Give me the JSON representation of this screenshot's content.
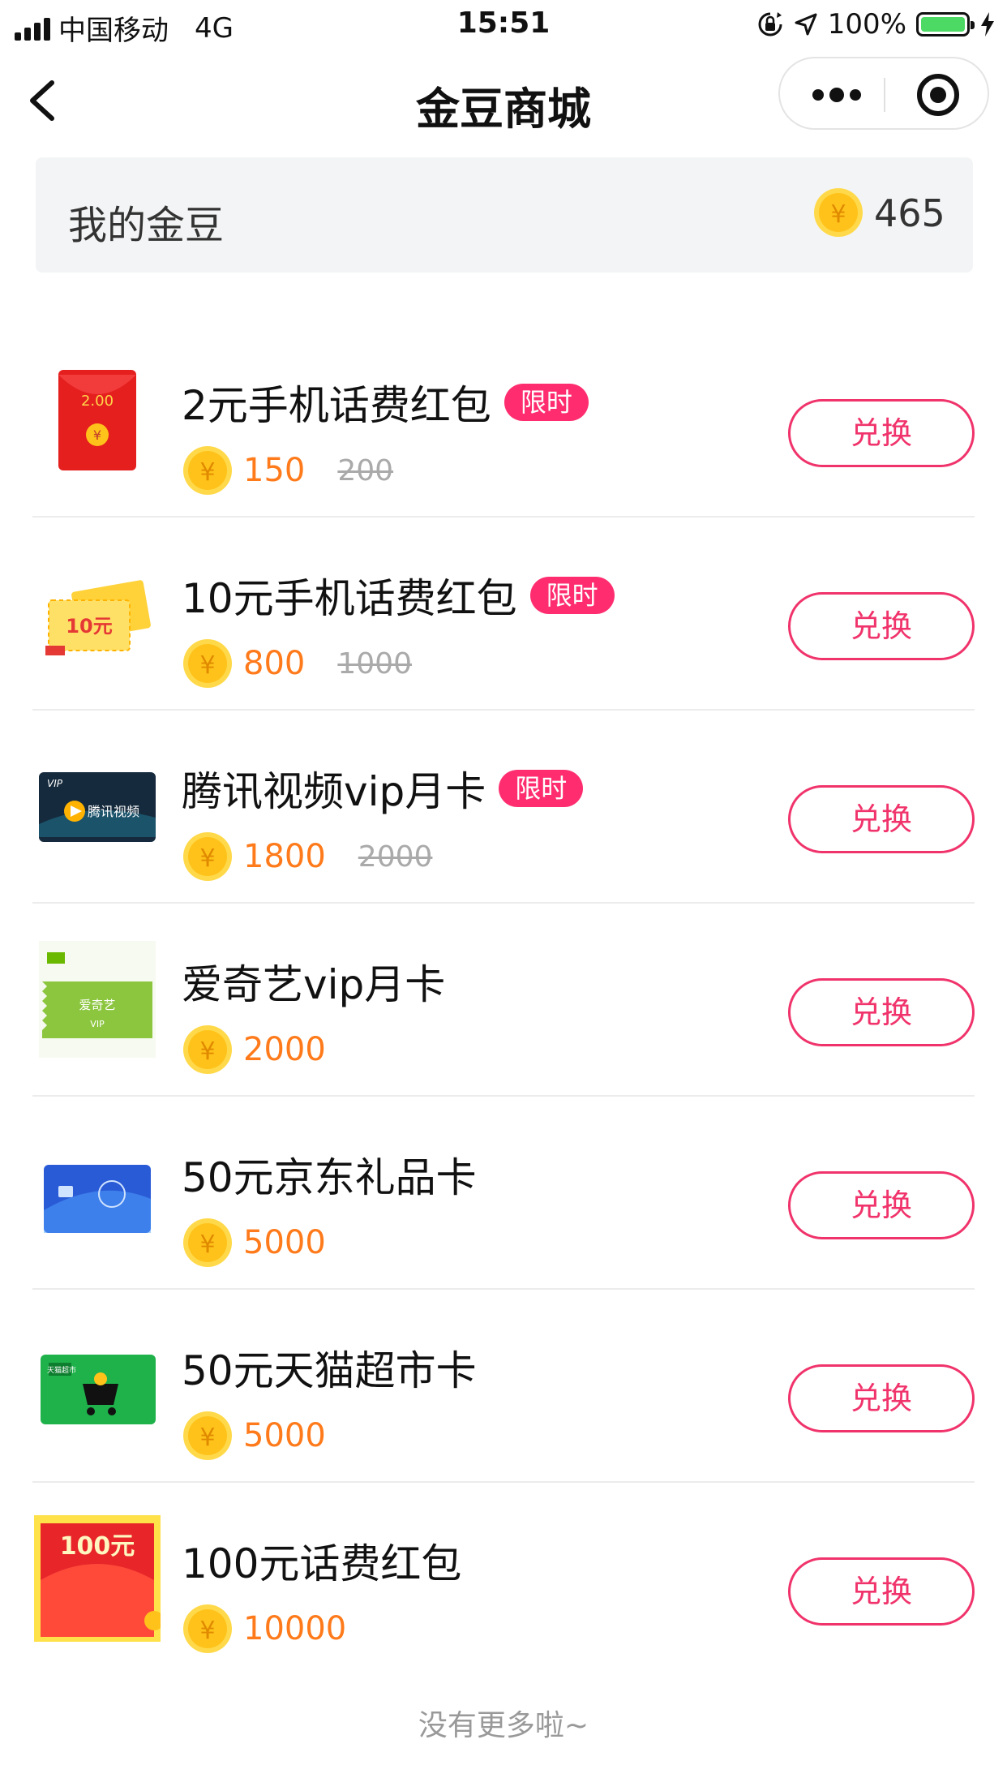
{
  "status_bar": {
    "carrier": "中国移动",
    "network": "4G",
    "time": "15:51",
    "battery": "100%",
    "battery_level": 1.0,
    "battery_color": "#4cd964"
  },
  "nav": {
    "title": "金豆商城",
    "back_icon": "chevron-left-icon",
    "more_icon": "more-dots-icon",
    "close_icon": "target-circle-icon"
  },
  "wallet": {
    "label": "我的金豆",
    "balance": "465",
    "coin_icon": "gold-coin-icon"
  },
  "colors": {
    "accent": "#f0336b",
    "badge": "#ff2d6f",
    "price": "#ff7a1a",
    "coin": "#ffc21a"
  },
  "exchange_label": "兑换",
  "items": [
    {
      "name": "2元手机话费红包",
      "badge": "限时",
      "price": "150",
      "original": "200",
      "thumb": "red-envelope-2yuan",
      "thumb_text": "2.00"
    },
    {
      "name": "10元手机话费红包",
      "badge": "限时",
      "price": "800",
      "original": "1000",
      "thumb": "yellow-coupons-10yuan",
      "thumb_text": "10元"
    },
    {
      "name": "腾讯视频vip月卡",
      "badge": "限时",
      "price": "1800",
      "original": "2000",
      "thumb": "tencent-video-card",
      "thumb_text": "腾讯视频"
    },
    {
      "name": "爱奇艺vip月卡",
      "badge": "",
      "price": "2000",
      "original": "",
      "thumb": "iqiyi-card",
      "thumb_text": "爱奇艺"
    },
    {
      "name": "50元京东礼品卡",
      "badge": "",
      "price": "5000",
      "original": "",
      "thumb": "jd-gift-card",
      "thumb_text": ""
    },
    {
      "name": "50元天猫超市卡",
      "badge": "",
      "price": "5000",
      "original": "",
      "thumb": "tmall-supermarket-card",
      "thumb_text": "天猫超市"
    },
    {
      "name": "100元话费红包",
      "badge": "",
      "price": "10000",
      "original": "",
      "thumb": "red-envelope-100yuan",
      "thumb_text": "100元"
    }
  ],
  "footer": "没有更多啦~"
}
